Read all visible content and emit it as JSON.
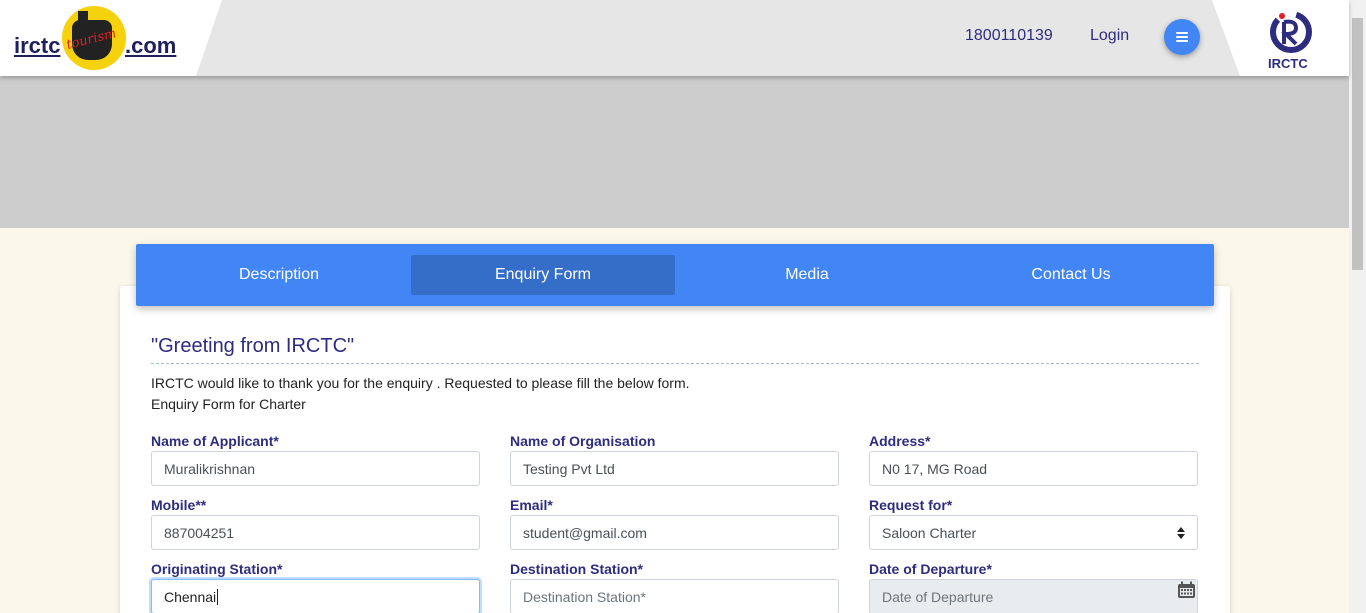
{
  "header": {
    "logo_left": {
      "text_a": "irctc",
      "text_b": ".com",
      "badge": "tourism"
    },
    "phone": "1800110139",
    "login": "Login",
    "logo_right_label": "IRCTC"
  },
  "tabs": [
    {
      "label": "Description",
      "active": false
    },
    {
      "label": "Enquiry Form",
      "active": true
    },
    {
      "label": "Media",
      "active": false
    },
    {
      "label": "Contact Us",
      "active": false
    }
  ],
  "form": {
    "greeting": "\"Greeting from IRCTC\"",
    "intro": "IRCTC would like to thank you for the enquiry . Requested to please fill the below form.",
    "subtitle": "Enquiry Form for Charter",
    "fields": {
      "applicant": {
        "label": "Name of Applicant*",
        "value": "Muralikrishnan"
      },
      "organisation": {
        "label": "Name of Organisation",
        "value": "Testing Pvt Ltd"
      },
      "address": {
        "label": "Address*",
        "value": "N0 17, MG Road"
      },
      "mobile": {
        "label": "Mobile**",
        "value": "887004251"
      },
      "email": {
        "label": "Email*",
        "value": "student@gmail.com"
      },
      "request_for": {
        "label": "Request for*",
        "value": "Saloon Charter"
      },
      "origin": {
        "label": "Originating Station*",
        "value": "Chennai"
      },
      "destination": {
        "label": "Destination Station*",
        "placeholder": "Destination Station*"
      },
      "departure": {
        "label": "Date of Departure*",
        "placeholder": "Date of Departure"
      }
    }
  },
  "colors": {
    "accent": "#4285f4",
    "tab_active": "#346ec8",
    "label_text": "#2e2c7e",
    "page_bg": "#fbf7ea",
    "banner": "#cccccc"
  }
}
